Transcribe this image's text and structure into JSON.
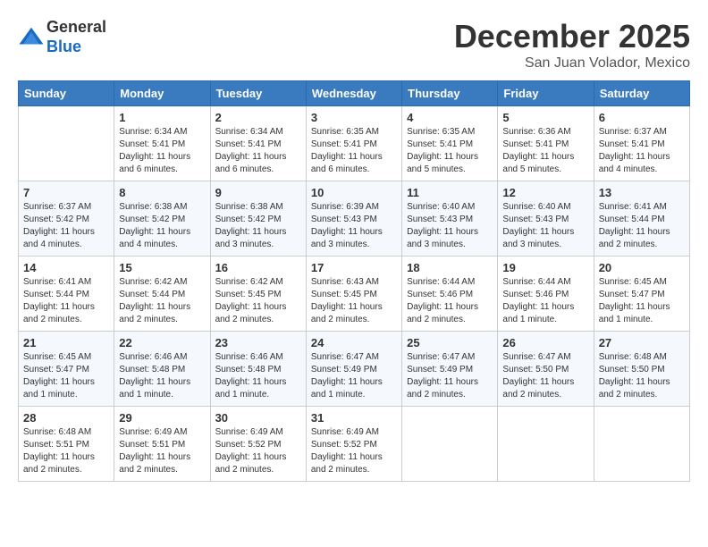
{
  "header": {
    "logo_line1": "General",
    "logo_line2": "Blue",
    "month": "December 2025",
    "location": "San Juan Volador, Mexico"
  },
  "weekdays": [
    "Sunday",
    "Monday",
    "Tuesday",
    "Wednesday",
    "Thursday",
    "Friday",
    "Saturday"
  ],
  "weeks": [
    [
      {
        "day": "",
        "info": ""
      },
      {
        "day": "1",
        "info": "Sunrise: 6:34 AM\nSunset: 5:41 PM\nDaylight: 11 hours\nand 6 minutes."
      },
      {
        "day": "2",
        "info": "Sunrise: 6:34 AM\nSunset: 5:41 PM\nDaylight: 11 hours\nand 6 minutes."
      },
      {
        "day": "3",
        "info": "Sunrise: 6:35 AM\nSunset: 5:41 PM\nDaylight: 11 hours\nand 6 minutes."
      },
      {
        "day": "4",
        "info": "Sunrise: 6:35 AM\nSunset: 5:41 PM\nDaylight: 11 hours\nand 5 minutes."
      },
      {
        "day": "5",
        "info": "Sunrise: 6:36 AM\nSunset: 5:41 PM\nDaylight: 11 hours\nand 5 minutes."
      },
      {
        "day": "6",
        "info": "Sunrise: 6:37 AM\nSunset: 5:41 PM\nDaylight: 11 hours\nand 4 minutes."
      }
    ],
    [
      {
        "day": "7",
        "info": "Sunrise: 6:37 AM\nSunset: 5:42 PM\nDaylight: 11 hours\nand 4 minutes."
      },
      {
        "day": "8",
        "info": "Sunrise: 6:38 AM\nSunset: 5:42 PM\nDaylight: 11 hours\nand 4 minutes."
      },
      {
        "day": "9",
        "info": "Sunrise: 6:38 AM\nSunset: 5:42 PM\nDaylight: 11 hours\nand 3 minutes."
      },
      {
        "day": "10",
        "info": "Sunrise: 6:39 AM\nSunset: 5:43 PM\nDaylight: 11 hours\nand 3 minutes."
      },
      {
        "day": "11",
        "info": "Sunrise: 6:40 AM\nSunset: 5:43 PM\nDaylight: 11 hours\nand 3 minutes."
      },
      {
        "day": "12",
        "info": "Sunrise: 6:40 AM\nSunset: 5:43 PM\nDaylight: 11 hours\nand 3 minutes."
      },
      {
        "day": "13",
        "info": "Sunrise: 6:41 AM\nSunset: 5:44 PM\nDaylight: 11 hours\nand 2 minutes."
      }
    ],
    [
      {
        "day": "14",
        "info": "Sunrise: 6:41 AM\nSunset: 5:44 PM\nDaylight: 11 hours\nand 2 minutes."
      },
      {
        "day": "15",
        "info": "Sunrise: 6:42 AM\nSunset: 5:44 PM\nDaylight: 11 hours\nand 2 minutes."
      },
      {
        "day": "16",
        "info": "Sunrise: 6:42 AM\nSunset: 5:45 PM\nDaylight: 11 hours\nand 2 minutes."
      },
      {
        "day": "17",
        "info": "Sunrise: 6:43 AM\nSunset: 5:45 PM\nDaylight: 11 hours\nand 2 minutes."
      },
      {
        "day": "18",
        "info": "Sunrise: 6:44 AM\nSunset: 5:46 PM\nDaylight: 11 hours\nand 2 minutes."
      },
      {
        "day": "19",
        "info": "Sunrise: 6:44 AM\nSunset: 5:46 PM\nDaylight: 11 hours\nand 1 minute."
      },
      {
        "day": "20",
        "info": "Sunrise: 6:45 AM\nSunset: 5:47 PM\nDaylight: 11 hours\nand 1 minute."
      }
    ],
    [
      {
        "day": "21",
        "info": "Sunrise: 6:45 AM\nSunset: 5:47 PM\nDaylight: 11 hours\nand 1 minute."
      },
      {
        "day": "22",
        "info": "Sunrise: 6:46 AM\nSunset: 5:48 PM\nDaylight: 11 hours\nand 1 minute."
      },
      {
        "day": "23",
        "info": "Sunrise: 6:46 AM\nSunset: 5:48 PM\nDaylight: 11 hours\nand 1 minute."
      },
      {
        "day": "24",
        "info": "Sunrise: 6:47 AM\nSunset: 5:49 PM\nDaylight: 11 hours\nand 1 minute."
      },
      {
        "day": "25",
        "info": "Sunrise: 6:47 AM\nSunset: 5:49 PM\nDaylight: 11 hours\nand 2 minutes."
      },
      {
        "day": "26",
        "info": "Sunrise: 6:47 AM\nSunset: 5:50 PM\nDaylight: 11 hours\nand 2 minutes."
      },
      {
        "day": "27",
        "info": "Sunrise: 6:48 AM\nSunset: 5:50 PM\nDaylight: 11 hours\nand 2 minutes."
      }
    ],
    [
      {
        "day": "28",
        "info": "Sunrise: 6:48 AM\nSunset: 5:51 PM\nDaylight: 11 hours\nand 2 minutes."
      },
      {
        "day": "29",
        "info": "Sunrise: 6:49 AM\nSunset: 5:51 PM\nDaylight: 11 hours\nand 2 minutes."
      },
      {
        "day": "30",
        "info": "Sunrise: 6:49 AM\nSunset: 5:52 PM\nDaylight: 11 hours\nand 2 minutes."
      },
      {
        "day": "31",
        "info": "Sunrise: 6:49 AM\nSunset: 5:52 PM\nDaylight: 11 hours\nand 2 minutes."
      },
      {
        "day": "",
        "info": ""
      },
      {
        "day": "",
        "info": ""
      },
      {
        "day": "",
        "info": ""
      }
    ]
  ]
}
